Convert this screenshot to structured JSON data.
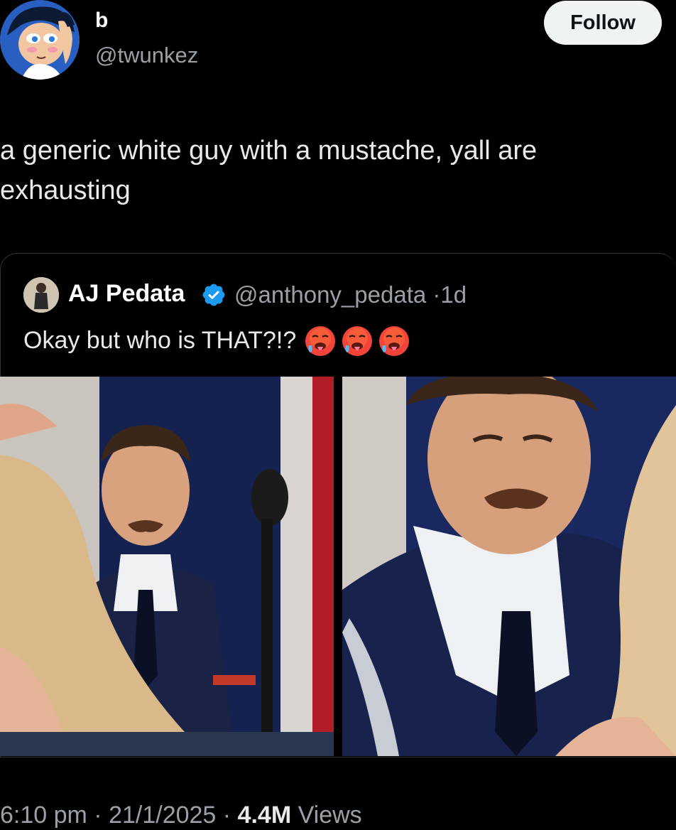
{
  "author": {
    "display_name": "b",
    "handle": "@twunkez",
    "avatar_icon": "cartoon-avatar-icon"
  },
  "follow_label": "Follow",
  "tweet_text": "a generic white guy with a mustache, yall are exhausting",
  "quoted": {
    "display_name": "AJ Pedata",
    "verified_icon": "verified-badge-icon",
    "handle": "@anthony_pedata",
    "separator": "·",
    "time": "1d",
    "text": "Okay but who is THAT?!?",
    "emojis": [
      "hot-face-emoji",
      "hot-face-emoji",
      "hot-face-emoji"
    ],
    "media": [
      "video-still-wide",
      "video-still-closeup"
    ]
  },
  "meta": {
    "time": "6:10 pm",
    "sep1": " · ",
    "date": "21/1/2025",
    "sep2": " · ",
    "views_count": "4.4M",
    "views_label": " Views"
  },
  "colors": {
    "background": "#000000",
    "text": "#e7e9ea",
    "secondary": "#9aa0a6",
    "verified": "#1d9bf0",
    "follow_bg": "#eff3f4"
  }
}
